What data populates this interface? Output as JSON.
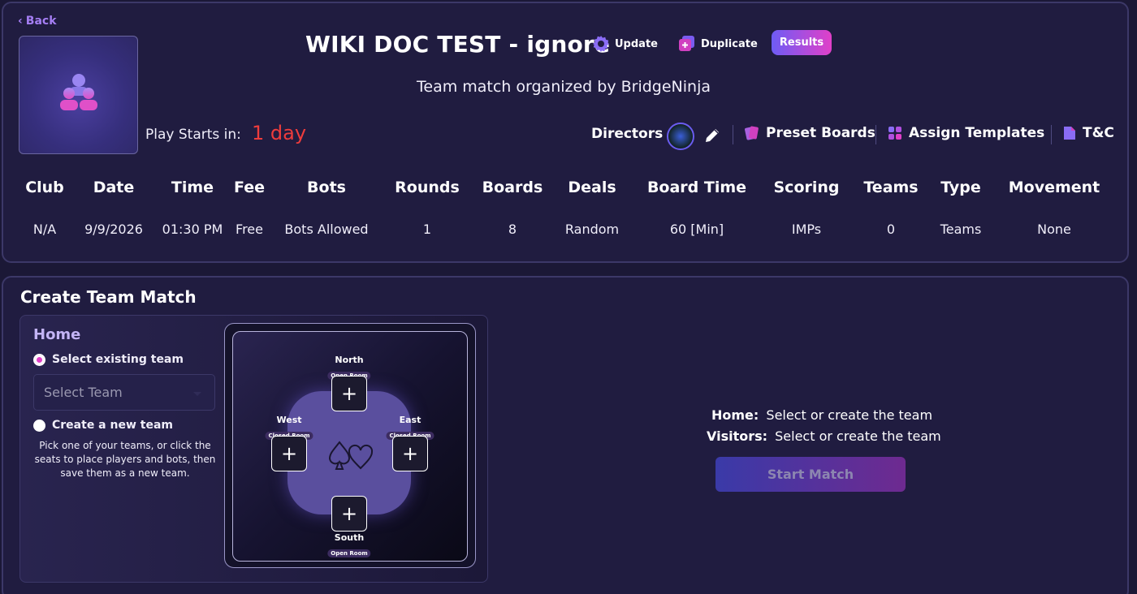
{
  "nav": {
    "back_label": "Back"
  },
  "header": {
    "title": "WIKI DOC TEST - ignore",
    "update_label": "Update",
    "duplicate_label": "Duplicate",
    "results_label": "Results",
    "subtitle": "Team match organized by BridgeNinja"
  },
  "play": {
    "label": "Play Starts in:",
    "value": "1 day"
  },
  "tools": {
    "directors_label": "Directors",
    "preset_boards_label": "Preset Boards",
    "assign_templates_label": "Assign Templates",
    "tc_label": "T&C"
  },
  "info": {
    "headers": [
      "Club",
      "Date",
      "Time",
      "Fee",
      "Bots",
      "Rounds",
      "Boards",
      "Deals",
      "Board Time",
      "Scoring",
      "Teams",
      "Type",
      "Movement"
    ],
    "values": [
      "N/A",
      "9/9/2026",
      "01:30 PM",
      "Free",
      "Bots Allowed",
      "1",
      "8",
      "Random",
      "60 [Min]",
      "IMPs",
      "0",
      "Teams",
      "None"
    ]
  },
  "create": {
    "section_title": "Create Team Match",
    "home_title": "Home",
    "radio_existing": "Select existing team",
    "select_placeholder": "Select Team",
    "radio_new": "Create a new team",
    "help_text": "Pick one of your teams, or click the seats to place players and bots, then save them as a new team.",
    "seats": {
      "north": {
        "name": "North",
        "room": "Open Room"
      },
      "west": {
        "name": "West",
        "room": "Closed Room"
      },
      "east": {
        "name": "East",
        "room": "Closed Room"
      },
      "south": {
        "name": "South",
        "room": "Open Room"
      },
      "add_symbol": "+"
    },
    "status": {
      "home_label": "Home:",
      "home_value": "Select or create the team",
      "visitors_label": "Visitors:",
      "visitors_value": "Select or create the team"
    },
    "start_label": "Start Match"
  },
  "colors": {
    "background": "#1b1836",
    "accent": "#a57ef4",
    "countdown": "#ee3c3c",
    "results_gradient": [
      "#6e5cf5",
      "#e040c8"
    ]
  },
  "icons": [
    "chevron-left-icon",
    "team-icon",
    "gear-icon",
    "duplicate-icon",
    "pencil-icon",
    "cards-icon",
    "grid-icon",
    "document-icon",
    "spade-heart-icon"
  ]
}
